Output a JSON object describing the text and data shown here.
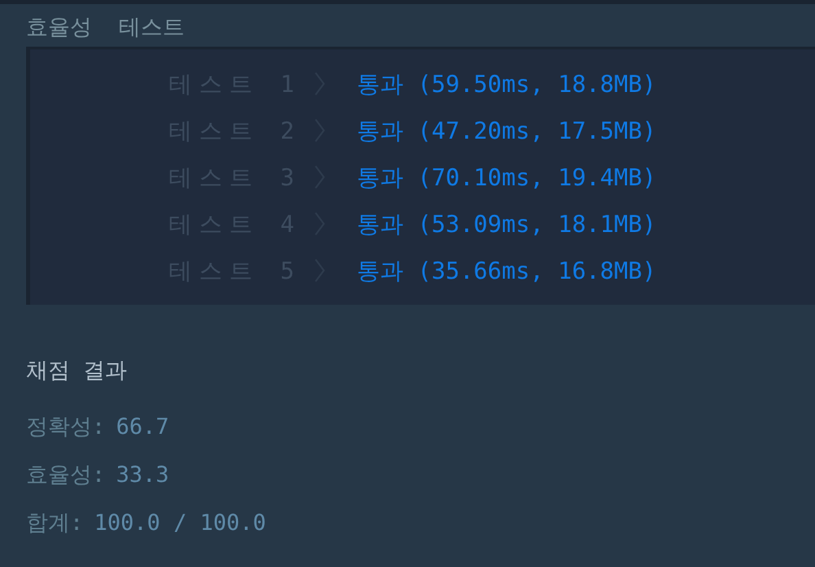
{
  "section_title": "효율성  테스트",
  "tests": [
    {
      "label": "테스트 1",
      "status": "통과",
      "detail": "(59.50ms, 18.8MB)"
    },
    {
      "label": "테스트 2",
      "status": "통과",
      "detail": "(47.20ms, 17.5MB)"
    },
    {
      "label": "테스트 3",
      "status": "통과",
      "detail": "(70.10ms, 19.4MB)"
    },
    {
      "label": "테스트 4",
      "status": "통과",
      "detail": "(53.09ms, 18.1MB)"
    },
    {
      "label": "테스트 5",
      "status": "통과",
      "detail": "(35.66ms, 16.8MB)"
    }
  ],
  "result": {
    "title": "채점 결과",
    "lines": [
      {
        "label": "정확성:",
        "value": "66.7"
      },
      {
        "label": "효율성:",
        "value": "33.3"
      },
      {
        "label": "합계:",
        "value": "100.0 / 100.0"
      }
    ]
  }
}
